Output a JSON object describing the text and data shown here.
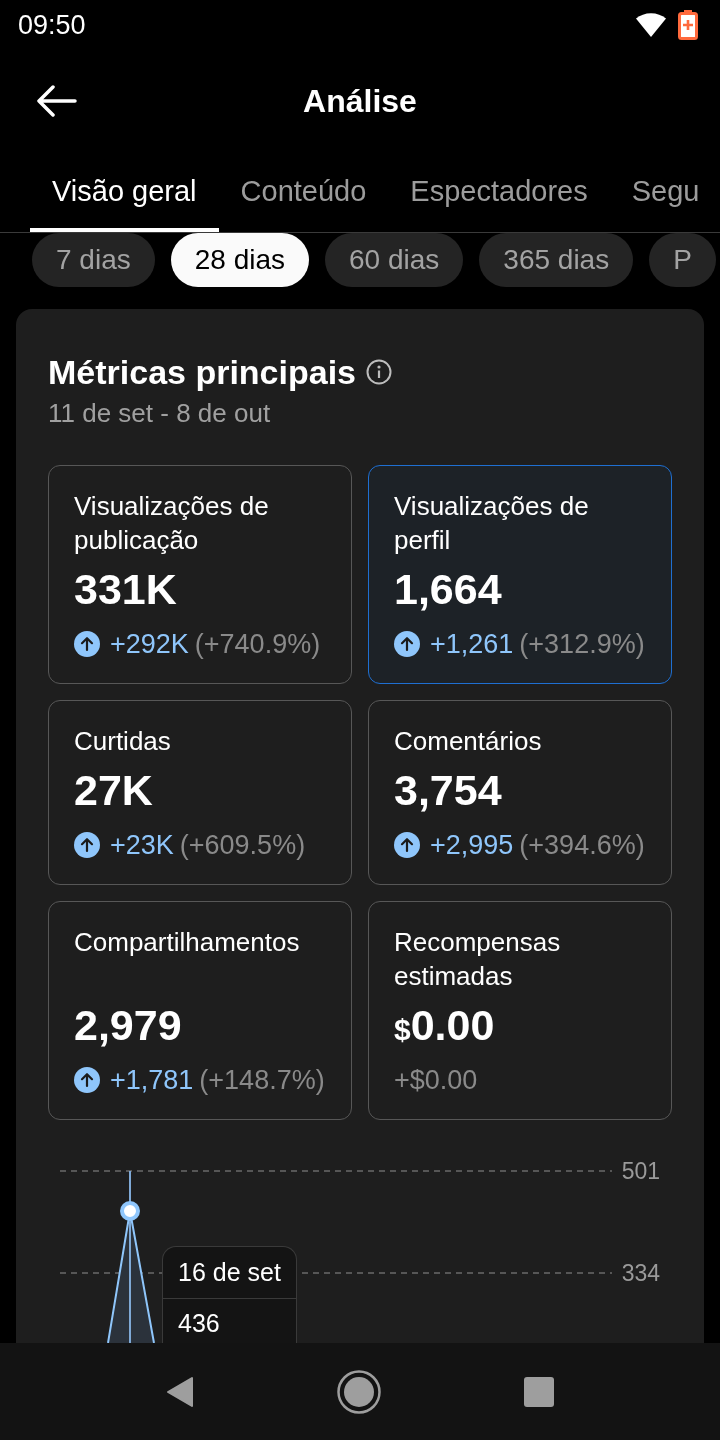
{
  "status_bar": {
    "time": "09:50"
  },
  "header": {
    "title": "Análise"
  },
  "tabs": [
    {
      "label": "Visão geral",
      "selected": true
    },
    {
      "label": "Conteúdo",
      "selected": false
    },
    {
      "label": "Espectadores",
      "selected": false
    },
    {
      "label": "Segu",
      "selected": false
    }
  ],
  "periods": [
    {
      "label": "7 dias",
      "selected": false
    },
    {
      "label": "28 dias",
      "selected": true
    },
    {
      "label": "60 dias",
      "selected": false
    },
    {
      "label": "365 dias",
      "selected": false
    },
    {
      "label": "P",
      "selected": false
    }
  ],
  "metrics_card": {
    "title": "Métricas principais",
    "date_range": "11 de set - 8 de out",
    "metrics": [
      {
        "kind": "up",
        "label": "Visualizações de publicação",
        "value": "331K",
        "change": "+292K",
        "percent": "(+740.9%)",
        "selected": false
      },
      {
        "kind": "up",
        "label": "Visualizações de perfil",
        "value": "1,664",
        "change": "+1,261",
        "percent": "(+312.9%)",
        "selected": true
      },
      {
        "kind": "up",
        "label": "Curtidas",
        "value": "27K",
        "change": "+23K",
        "percent": "(+609.5%)",
        "selected": false
      },
      {
        "kind": "up",
        "label": "Comentários",
        "value": "3,754",
        "change": "+2,995",
        "percent": "(+394.6%)",
        "selected": false
      },
      {
        "kind": "up",
        "label": "Compartilhamentos",
        "value": "2,979",
        "change": "+1,781",
        "percent": "(+148.7%)",
        "selected": false
      },
      {
        "kind": "plain",
        "label": "Recompensas estimadas",
        "currency": "$",
        "value": "0.00",
        "change": "+$0.00",
        "selected": false
      }
    ],
    "chart": {
      "y_labels": [
        "501",
        "334"
      ],
      "tooltip": {
        "date": "16 de set",
        "value": "436"
      }
    }
  }
}
